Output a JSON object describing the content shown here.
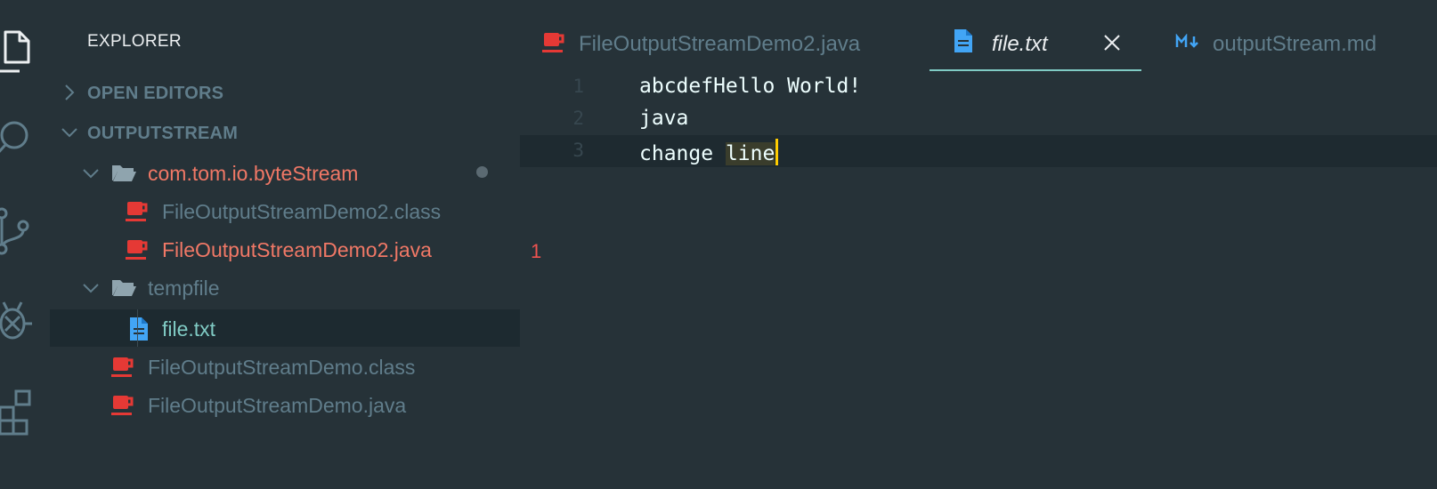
{
  "sidebar": {
    "title": "EXPLORER",
    "sections": [
      {
        "label": "OPEN EDITORS",
        "expanded": false
      },
      {
        "label": "OUTPUTSTREAM",
        "expanded": true
      }
    ],
    "tree": [
      {
        "label": "com.tom.io.byteStream",
        "type": "folder",
        "color": "#f07866"
      },
      {
        "label": "FileOutputStreamDemo2.class",
        "type": "java",
        "color": "#607d8b"
      },
      {
        "label": "FileOutputStreamDemo2.java",
        "type": "java",
        "color": "#f07866",
        "problems": "1"
      },
      {
        "label": "tempfile",
        "type": "folder",
        "color": "#607d8b"
      },
      {
        "label": "file.txt",
        "type": "text",
        "color": "#80cbc4"
      },
      {
        "label": "FileOutputStreamDemo.class",
        "type": "java",
        "color": "#607d8b"
      },
      {
        "label": "FileOutputStreamDemo.java",
        "type": "java",
        "color": "#607d8b"
      }
    ]
  },
  "tabs": [
    {
      "label": "FileOutputStreamDemo2.java",
      "icon": "java-icon",
      "active": false
    },
    {
      "label": "file.txt",
      "icon": "file-text-icon",
      "active": true
    },
    {
      "label": "outputStream.md",
      "icon": "markdown-icon",
      "active": false
    }
  ],
  "editor": {
    "lines": [
      {
        "number": "1",
        "text": "abcdefHello World!"
      },
      {
        "number": "2",
        "text": "java"
      },
      {
        "number": "3",
        "text_before": "change ",
        "text_highlight": "line"
      }
    ]
  },
  "colors": {
    "background": "#263238",
    "accent": "#80cbc4",
    "cursor": "#ffcc00",
    "error": "#ef5350",
    "java_icon": "#e53935",
    "file_icon": "#42a5f5"
  }
}
